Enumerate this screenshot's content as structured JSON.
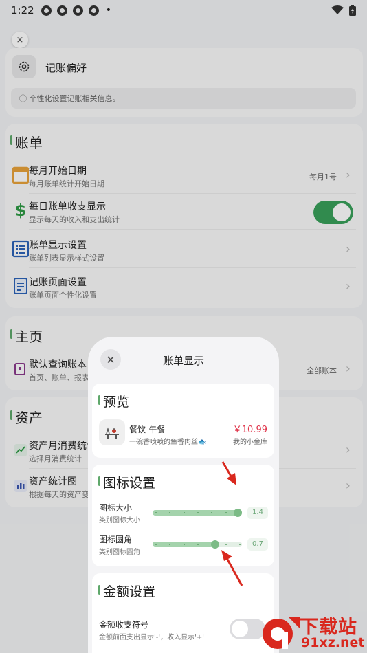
{
  "status_bar": {
    "time": "1:22",
    "bullet": "•"
  },
  "preferences": {
    "close_glyph": "×",
    "title": "记账偏好",
    "note": "个性化设置记账相关信息。"
  },
  "bill_section": {
    "title": "账单",
    "rows": [
      {
        "title": "每月开始日期",
        "subtitle": "每月账单统计开始日期",
        "value": "每月1号"
      },
      {
        "title": "每日账单收支显示",
        "subtitle": "显示每天的收入和支出统计",
        "toggle_on": true
      },
      {
        "title": "账单显示设置",
        "subtitle": "账单列表显示样式设置"
      },
      {
        "title": "记账页面设置",
        "subtitle": "账单页面个性化设置"
      }
    ]
  },
  "home_section": {
    "title": "主页",
    "rows": [
      {
        "title": "默认查询账本",
        "subtitle": "首页、账单、报表",
        "value": "全部账本"
      }
    ]
  },
  "asset_section": {
    "title": "资产",
    "rows": [
      {
        "title": "资产月消费统计",
        "subtitle": "选择月消费统计"
      },
      {
        "title": "资产统计图",
        "subtitle": "根据每天的资产变"
      }
    ]
  },
  "sheet": {
    "close_glyph": "✕",
    "title": "账单显示",
    "preview": {
      "title": "预览",
      "item_name": "餐饮-午餐",
      "item_note": "一碗香喷喷的鱼香肉丝🐟",
      "amount": "￥10.99",
      "book": "我的小金库"
    },
    "icon_settings": {
      "title": "图标设置",
      "size": {
        "title": "图标大小",
        "subtitle": "类别图标大小",
        "value": "1.4",
        "fraction": 1.0
      },
      "radius": {
        "title": "图标圆角",
        "subtitle": "类别图标圆角",
        "value": "0.7",
        "fraction": 0.7
      }
    },
    "amount_settings": {
      "title": "金额设置",
      "sign_title": "金额收支符号",
      "sign_subtitle": "金额前面支出显示'-'，收入显示'+'",
      "toggle_on": false,
      "grip": "⌄"
    }
  },
  "watermark": {
    "brand": "下载站",
    "domain": "91xz.net"
  },
  "colors": {
    "accent": "#39a05a",
    "amount_red": "#e0344a",
    "watermark_red": "#d9281e",
    "arrow_red": "#d9281e"
  }
}
